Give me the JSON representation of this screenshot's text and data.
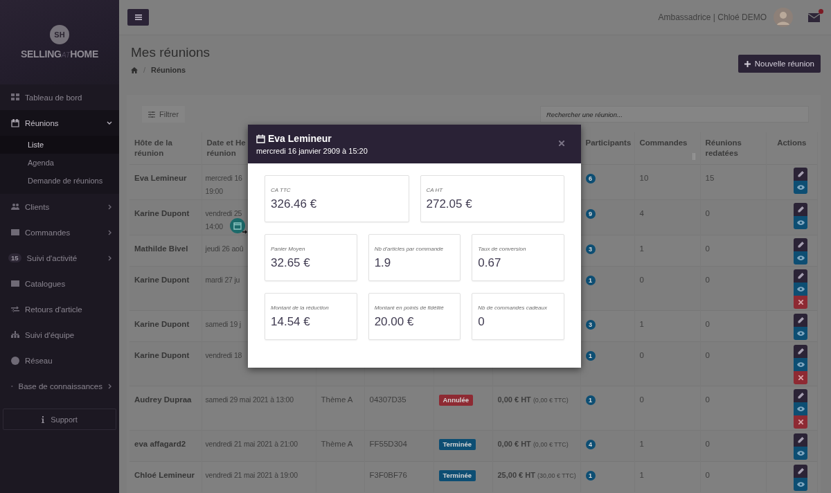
{
  "sidebar": {
    "logo": {
      "monogram": "SH",
      "word_1": "SELLING",
      "word_2": "AT",
      "word_3": "HOME"
    },
    "items": [
      {
        "label": "Tableau de bord"
      },
      {
        "label": "Réunions",
        "expanded": true,
        "children": [
          {
            "label": "Liste",
            "selected": true
          },
          {
            "label": "Agenda",
            "selected": false
          },
          {
            "label": "Demande de réunions",
            "selected": false
          }
        ]
      },
      {
        "label": "Clients",
        "expanded": false
      },
      {
        "label": "Commandes",
        "expanded": false
      },
      {
        "label": "Suivi d'activité",
        "badge": "15",
        "expanded": false
      },
      {
        "label": "Catalogues"
      },
      {
        "label": "Retours d'article"
      },
      {
        "label": "Suivi d'équipe"
      },
      {
        "label": "Réseau"
      },
      {
        "label": "Base de connaissances",
        "expanded": false
      }
    ],
    "support": "Support"
  },
  "topbar": {
    "user": "Ambassadrice | Chloé DEMO",
    "unread": true
  },
  "page": {
    "title": "Mes réunions",
    "breadcrumb": {
      "separator": "/",
      "current": "Réunions"
    },
    "new_button": "Nouvelle réunion"
  },
  "toolbar": {
    "filter": "Filtrer",
    "search_placeholder": "Rechercher une réunion..."
  },
  "table": {
    "columns": [
      {
        "lines": [
          "Hôte de la",
          "réunion"
        ]
      },
      {
        "lines": [
          "Date et He",
          "réunion"
        ]
      },
      {},
      {},
      {},
      {},
      {
        "lines": [
          "Participants"
        ]
      },
      {
        "lines": [
          "Commandes"
        ],
        "sortable": true
      },
      {
        "lines": [
          "Réunions",
          "redatées"
        ]
      },
      {
        "lines": [
          "Actions"
        ]
      }
    ],
    "rows": [
      {
        "host": "Eva Lemineur",
        "date": [
          "mercredi 16",
          "19:00"
        ],
        "participants": "6",
        "orders": "10",
        "rescheduled": "15",
        "actions": [
          {
            "kind": "edit"
          },
          {
            "kind": "view"
          }
        ]
      },
      {
        "host": "Karine Dupont",
        "date": [
          "vendredi 25",
          "14:00"
        ],
        "calendar_badge": true,
        "participants": "9",
        "orders": "4",
        "rescheduled": "0",
        "actions": [
          {
            "kind": "edit"
          },
          {
            "kind": "view"
          }
        ]
      },
      {
        "host": "Mathilde Bivel",
        "date": [
          "jeudi 26 aoû"
        ],
        "participants": "3",
        "orders": "1",
        "rescheduled": "0",
        "actions": [
          {
            "kind": "edit"
          },
          {
            "kind": "view"
          }
        ]
      },
      {
        "host": "Karine Dupont",
        "date": [
          "mardi 27 ju"
        ],
        "participants": "1",
        "orders": "0",
        "rescheduled": "0",
        "actions": [
          {
            "kind": "edit"
          },
          {
            "kind": "view"
          },
          {
            "kind": "delete"
          }
        ]
      },
      {
        "host": "Karine Dupont",
        "date": [
          "samedi 19 j"
        ],
        "participants": "3",
        "orders": "1",
        "rescheduled": "0",
        "actions": [
          {
            "kind": "edit"
          },
          {
            "kind": "view"
          }
        ]
      },
      {
        "host": "Karine Dupont",
        "date": [
          "vendredi 18"
        ],
        "participants": "1",
        "orders": "0",
        "rescheduled": "0",
        "actions": [
          {
            "kind": "edit"
          },
          {
            "kind": "view"
          },
          {
            "kind": "delete"
          }
        ]
      },
      {
        "host": "Audrey Dupraa",
        "date": [
          "samedi 29 mai 2021 à 13:00"
        ],
        "theme": "Thème A",
        "code": "04307D35",
        "status": {
          "label": "Annulée",
          "kind": "cancelled"
        },
        "amount_ht": "0,00 € HT",
        "amount_ttc": "(0,00 € TTC)",
        "participants": "1",
        "orders": "0",
        "rescheduled": "0",
        "actions": [
          {
            "kind": "edit"
          },
          {
            "kind": "view"
          },
          {
            "kind": "delete"
          }
        ]
      },
      {
        "host": "eva affagard2",
        "date": [
          "vendredi 21 mai 2021 à 21:00"
        ],
        "theme": "Thème A",
        "code": "FF55D304",
        "status": {
          "label": "Terminée",
          "kind": "done"
        },
        "amount_ht": "0,00 € HT",
        "amount_ttc": "(0,00 € TTC)",
        "participants": "4",
        "orders": "1",
        "rescheduled": "0",
        "actions": [
          {
            "kind": "edit"
          },
          {
            "kind": "view"
          }
        ]
      },
      {
        "host": "Chloé Lemineur",
        "date": [
          "vendredi 21 mai 2021 à 19:00"
        ],
        "code": "F3F0BF76",
        "status": {
          "label": "Terminée",
          "kind": "done"
        },
        "amount_ht": "25,00 € HT",
        "amount_ttc": "(30,00 € TTC)",
        "participants": "1",
        "orders": "1",
        "rescheduled": "0",
        "actions": [
          {
            "kind": "edit"
          },
          {
            "kind": "view"
          }
        ]
      }
    ]
  },
  "modal": {
    "title": "Eva Lemineur",
    "subtitle": "mercredi 16 janvier 2909 à 15:20",
    "stat_rows": [
      [
        {
          "label": "CA TTC",
          "value": "326.46 €"
        },
        {
          "label": "CA HT",
          "value": "272.05 €"
        }
      ],
      [
        {
          "label": "Panier Moyen",
          "value": "32.65 €"
        },
        {
          "label": "Nb d'articles par commande",
          "value": "1.9"
        },
        {
          "label": "Taux de conversion",
          "value": "0.67"
        }
      ],
      [
        {
          "label": "Montant de la réduction",
          "value": "14.54 €"
        },
        {
          "label": "Montant en points de fidélité",
          "value": "20.00 €"
        },
        {
          "label": "Nb de commandes cadeaux",
          "value": "0"
        }
      ]
    ]
  }
}
